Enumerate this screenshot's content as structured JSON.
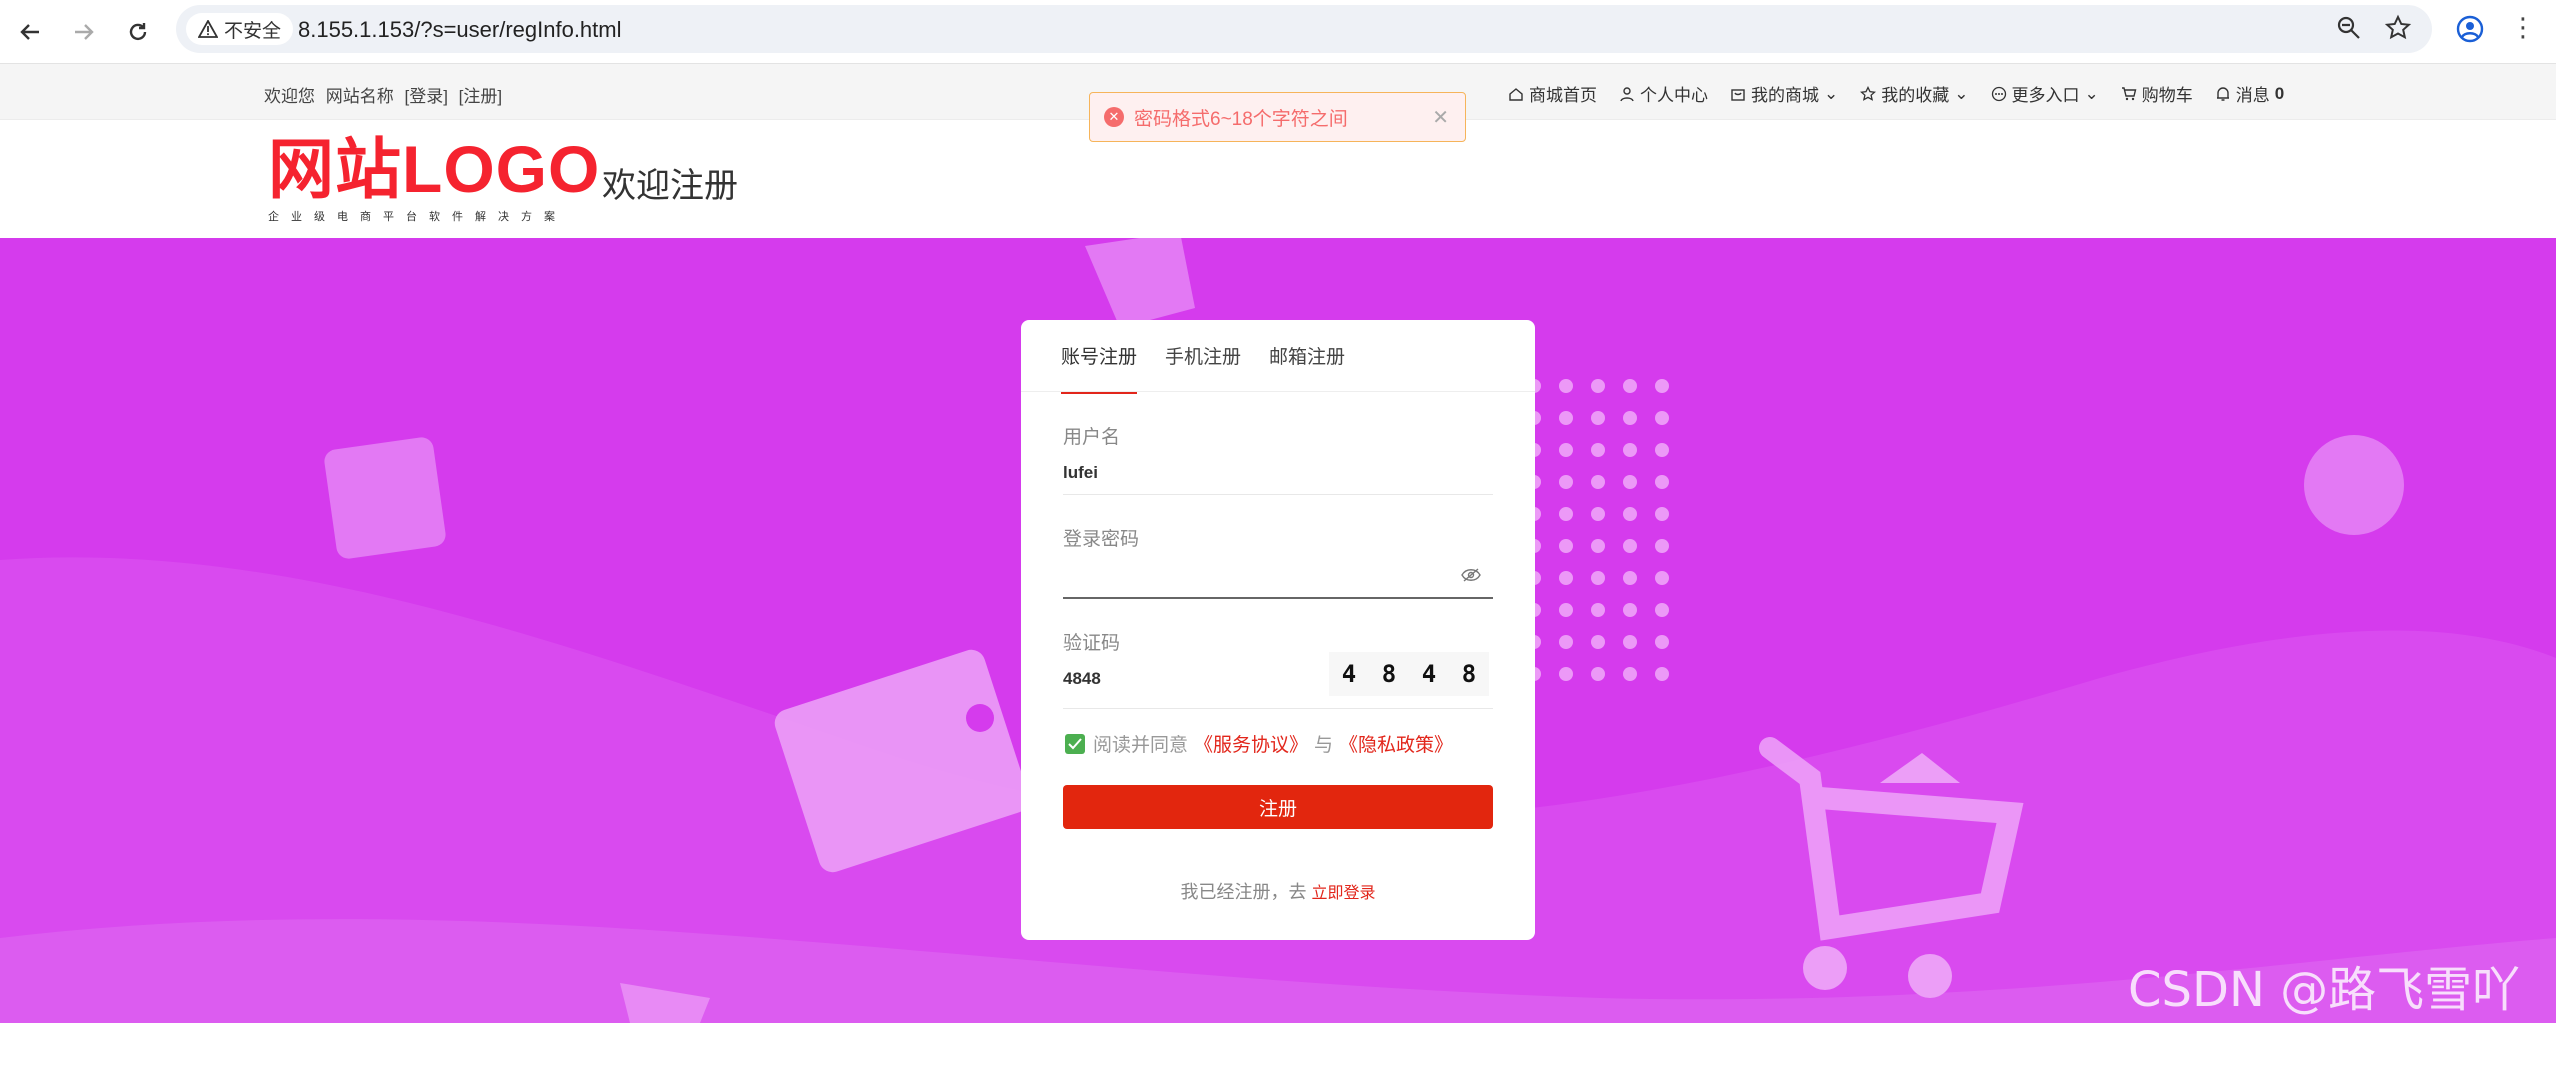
{
  "browser": {
    "security_label": "不安全",
    "url": "8.155.1.153/?s=user/regInfo.html"
  },
  "topbar": {
    "welcome": "欢迎您",
    "site_name": "网站名称",
    "login": "[登录]",
    "register": "[注册]",
    "links": [
      {
        "label": "商城首页",
        "icon": "home-icon"
      },
      {
        "label": "个人中心",
        "icon": "user-icon"
      },
      {
        "label": "我的商城",
        "icon": "shop-icon"
      },
      {
        "label": "我的收藏",
        "icon": "star-icon"
      },
      {
        "label": "更多入口",
        "icon": "more-icon"
      },
      {
        "label": "购物车",
        "icon": "cart-icon"
      },
      {
        "label": "消息",
        "icon": "bell-icon",
        "count": "0"
      }
    ]
  },
  "header": {
    "logo_text": "网站LOGO",
    "logo_sub": "企业级电商平台软件解决方案",
    "title": "欢迎注册"
  },
  "toast": {
    "message": "密码格式6~18个字符之间"
  },
  "form": {
    "tabs": [
      "账号注册",
      "手机注册",
      "邮箱注册"
    ],
    "active_tab": "账号注册",
    "username_label": "用户名",
    "username_value": "lufei",
    "password_label": "登录密码",
    "password_value": "",
    "captcha_label": "验证码",
    "captcha_value": "4848",
    "captcha_image_text": [
      "4",
      "8",
      "4",
      "8"
    ],
    "agree_text": "阅读并同意",
    "service_link": "《服务协议》",
    "and_text": "与",
    "privacy_link": "《隐私政策》",
    "agree_checked": true,
    "submit_label": "注册",
    "already_text": "我已经注册，去",
    "login_link": "立即登录"
  },
  "watermark": "CSDN @路飞雪吖~",
  "colors": {
    "hero_bg": "#d53bed",
    "accent_red": "#e2260e",
    "logo_red": "#f5232f"
  }
}
